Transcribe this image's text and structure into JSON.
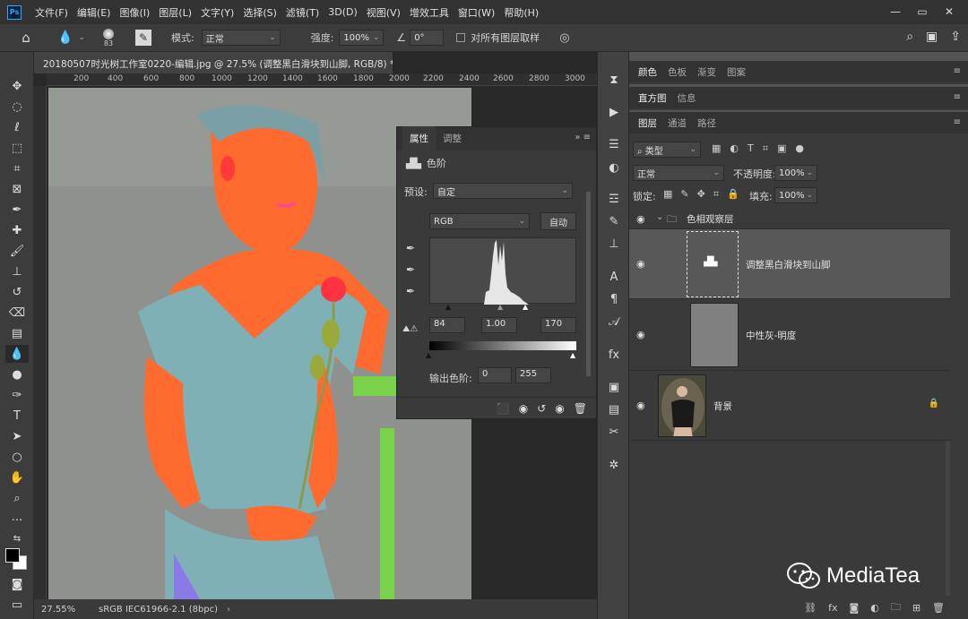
{
  "menu": {
    "logo": "Ps",
    "items": [
      "文件(F)",
      "编辑(E)",
      "图像(I)",
      "图层(L)",
      "文字(Y)",
      "选择(S)",
      "滤镜(T)",
      "3D(D)",
      "视图(V)",
      "增效工具",
      "窗口(W)",
      "帮助(H)"
    ]
  },
  "options": {
    "brush_size": "83",
    "mode_label": "模式:",
    "mode_value": "正常",
    "strength_label": "强度:",
    "strength_value": "100%",
    "angle_value": "0°",
    "sample_all_label": "对所有图层取样"
  },
  "document": {
    "tab_title": "20180507时光树工作室0220-编辑.jpg @ 27.5% (调整黑白滑块到山脚, RGB/8) *",
    "ruler_ticks": [
      "200",
      "400",
      "600",
      "800",
      "1000",
      "1200",
      "1400",
      "1600",
      "1800",
      "2000",
      "2200",
      "2400",
      "2600",
      "2800",
      "3000"
    ],
    "zoom": "27.55%",
    "color_profile": "sRGB IEC61966-2.1 (8bpc)"
  },
  "properties": {
    "tabs": [
      "属性",
      "调整"
    ],
    "adjustment_name": "色阶",
    "preset_label": "预设:",
    "preset_value": "自定",
    "channel": "RGB",
    "auto_button": "自动",
    "input_black": "84",
    "input_mid": "1.00",
    "input_white": "170",
    "output_label": "输出色阶:",
    "output_black": "0",
    "output_white": "255"
  },
  "right": {
    "color_tabs": [
      "颜色",
      "色板",
      "渐变",
      "图案"
    ],
    "histo_tabs": [
      "直方图",
      "信息"
    ],
    "layer_tabs": [
      "图层",
      "通道",
      "路径"
    ],
    "filter_kind": "类型",
    "blend_mode": "正常",
    "opacity_label": "不透明度:",
    "opacity_value": "100%",
    "lock_label": "锁定:",
    "fill_label": "填充:",
    "fill_value": "100%",
    "layers": [
      {
        "name": "色相观察层"
      },
      {
        "name": "调整黑白滑块到山脚"
      },
      {
        "name": "中性灰-明度"
      },
      {
        "name": "背景"
      }
    ]
  },
  "watermark": "MediaTea",
  "colors": {
    "fg": "#000000",
    "bg": "#ffffff",
    "accent": "#31a8ff"
  }
}
